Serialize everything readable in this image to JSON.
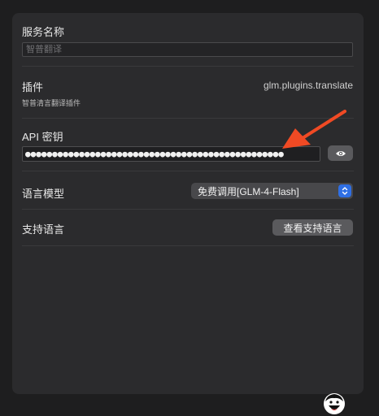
{
  "service_name": {
    "label": "服务名称",
    "value": "",
    "placeholder": "智普翻译"
  },
  "plugin": {
    "label": "插件",
    "id": "glm.plugins.translate",
    "description": "智普清言翻译插件"
  },
  "api_key": {
    "label": "API 密钥",
    "masked_value": "●●●●●●●●●●●●●●●●●●●●●●●●●●●●●●●●●●●●●●●●●●●●●●●●",
    "toggle_icon": "eye-icon"
  },
  "language_model": {
    "label": "语言模型",
    "selected": "免费调用[GLM-4-Flash]"
  },
  "supported_languages": {
    "label": "支持语言",
    "button_label": "查看支持语言"
  },
  "annotation": {
    "arrow_color": "#f04a24"
  },
  "colors": {
    "accent": "#2f6fe4",
    "panel": "#2b2b2d",
    "background": "#1e1e1f"
  }
}
